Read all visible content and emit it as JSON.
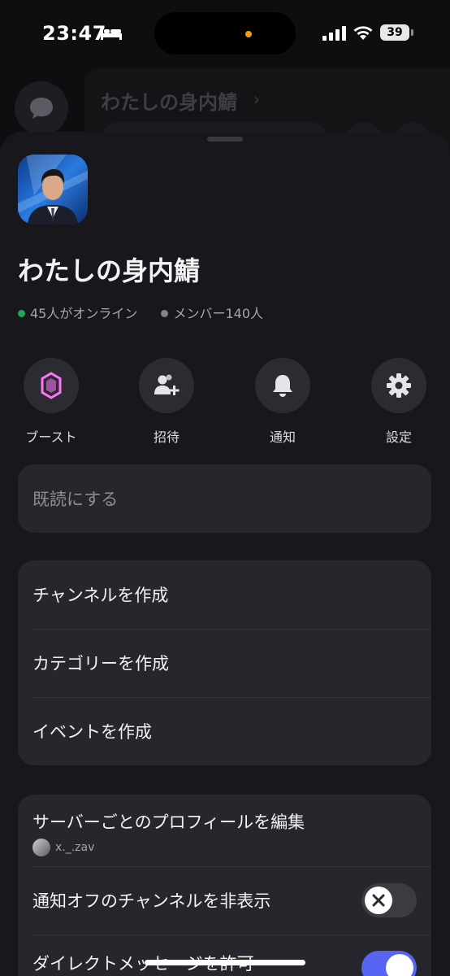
{
  "status_bar": {
    "time": "23:47",
    "battery": "39",
    "icons": [
      "bed-icon",
      "signal-icon",
      "wifi-icon",
      "battery-icon"
    ]
  },
  "background": {
    "server_title": "わたしの身内鯖",
    "chevron": "›"
  },
  "server": {
    "name": "わたしの身内鯖",
    "online": "45人がオンライン",
    "members": "メンバー140人",
    "online_color": "#23a55a"
  },
  "actions": [
    {
      "label": "ブースト",
      "icon": "boost-icon"
    },
    {
      "label": "招待",
      "icon": "invite-icon"
    },
    {
      "label": "通知",
      "icon": "bell-icon"
    },
    {
      "label": "設定",
      "icon": "gear-icon"
    }
  ],
  "mark_read": {
    "label": "既読にする"
  },
  "create_menu": {
    "items": [
      "チャンネルを作成",
      "カテゴリーを作成",
      "イベントを作成"
    ]
  },
  "settings_menu": {
    "edit_profile": "サーバーごとのプロフィールを編集",
    "username": "x._.zav",
    "hide_muted": "通知オフのチャンネルを非表示",
    "hide_muted_enabled": false,
    "allow_dm": "ダイレクトメッセージを許可",
    "allow_dm_enabled": true
  },
  "colors": {
    "accent": "#5865f2",
    "boost": "#ff73fa",
    "sheet": "#18181c",
    "card": "#26262c"
  }
}
